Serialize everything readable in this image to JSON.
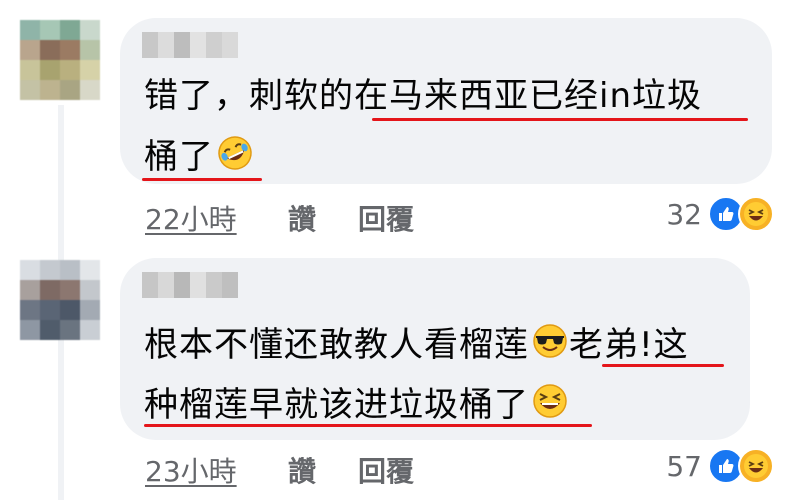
{
  "comments": [
    {
      "text_line1_pre": "错了，刺软的",
      "text_line1_post": "在马来西亚已经in垃圾",
      "text_line2": "桶了",
      "emoji": "rolling-on-floor-laughing",
      "time": "22小時",
      "like_label": "讚",
      "reply_label": "回覆",
      "reaction_count": "32"
    },
    {
      "text_line1": "根本不懂还敢教人看榴莲",
      "text_line1_emoji": "smiling-face-with-sunglasses",
      "text_line1_post": "老弟!这",
      "text_line2": "种榴莲早就该进垃圾桶了",
      "text_line2_emoji": "grinning-squinting-face",
      "time": "23小時",
      "like_label": "讚",
      "reply_label": "回覆",
      "reaction_count": "57"
    }
  ],
  "colors": {
    "bubble": "#f0f2f5",
    "underline": "#e4151a",
    "meta_text": "#65676b",
    "like_blue": "#1877f2",
    "haha_yellow": "#f7b125"
  }
}
